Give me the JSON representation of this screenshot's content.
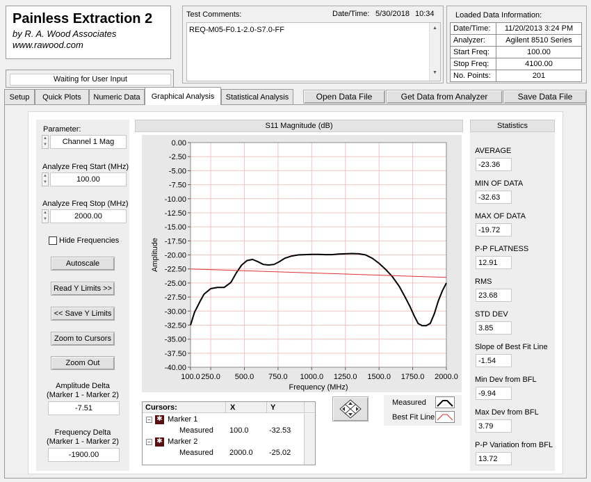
{
  "header": {
    "title": "Painless Extraction 2",
    "company": "by R. A. Wood Associates",
    "website": "www.rawood.com",
    "status": "Waiting for User Input"
  },
  "comments": {
    "label": "Test Comments:",
    "datetime_label": "Date/Time:",
    "date": "5/30/2018",
    "time": "10:34",
    "text": "REQ-M05-F0.1-2.0-S7.0-FF"
  },
  "loaded_data": {
    "title": "Loaded Data Information:",
    "rows": [
      {
        "key": "Date/Time:",
        "value": "11/20/2013 3:24 PM"
      },
      {
        "key": "Analyzer:",
        "value": "Agilent 8510 Series"
      },
      {
        "key": "Start Freq:",
        "value": "100.00"
      },
      {
        "key": "Stop Freq:",
        "value": "4100.00"
      },
      {
        "key": "No. Points:",
        "value": "201"
      }
    ]
  },
  "tabs": [
    "Setup",
    "Quick Plots",
    "Numeric Data",
    "Graphical Analysis",
    "Statistical Analysis"
  ],
  "actions": {
    "open": "Open Data File",
    "get": "Get Data from Analyzer",
    "save": "Save Data File"
  },
  "controls": {
    "parameter_label": "Parameter:",
    "parameter_value": "Channel 1 Mag",
    "start_label": "Analyze Freq Start (MHz)",
    "start_value": "100.00",
    "stop_label": "Analyze Freq Stop (MHz)",
    "stop_value": "2000.00",
    "hide_freq": "Hide Frequencies",
    "autoscale": "Autoscale",
    "read_y": "Read Y Limits >>",
    "save_y": "<< Save Y Limits",
    "zoom_cursors": "Zoom to Cursors",
    "zoom_out": "Zoom Out",
    "amp_delta_label1": "Amplitude Delta",
    "amp_delta_label2": "(Marker 1 - Marker 2)",
    "amp_delta_value": "-7.51",
    "freq_delta_label1": "Frequency Delta",
    "freq_delta_label2": "(Marker 1 - Marker 2)",
    "freq_delta_value": "-1900.00"
  },
  "cursors": {
    "header": "Cursors:",
    "col_x": "X",
    "col_y": "Y",
    "rows": [
      {
        "marker": "Marker 1",
        "trace": "Measured",
        "x": "100.0",
        "y": "-32.53"
      },
      {
        "marker": "Marker 2",
        "trace": "Measured",
        "x": "2000.0",
        "y": "-25.02"
      }
    ]
  },
  "legend": {
    "measured": "Measured",
    "bfl": "Best Fit Line"
  },
  "statistics": {
    "title": "Statistics",
    "items": [
      {
        "label": "AVERAGE",
        "value": "-23.36"
      },
      {
        "label": "MIN OF DATA",
        "value": "-32.63"
      },
      {
        "label": "MAX OF DATA",
        "value": "-19.72"
      },
      {
        "label": "P-P FLATNESS",
        "value": "12.91"
      },
      {
        "label": "RMS",
        "value": "23.68"
      },
      {
        "label": "STD DEV",
        "value": "3.85"
      },
      {
        "label": "Slope of Best Fit Line",
        "value": "-1.54"
      },
      {
        "label": "Min Dev from BFL",
        "value": "-9.94"
      },
      {
        "label": "Max Dev from BFL",
        "value": "3.79"
      },
      {
        "label": "P-P Variation from BFL",
        "value": "13.72"
      }
    ]
  },
  "chart_data": {
    "type": "line",
    "title": "S11 Magnitude (dB)",
    "xlabel": "Frequency (MHz)",
    "ylabel": "Amplitude",
    "xlim": [
      100,
      2000
    ],
    "ylim": [
      -40,
      0
    ],
    "xticks": [
      "100.0",
      "250.0",
      "500.0",
      "750.0",
      "1000.0",
      "1250.0",
      "1500.0",
      "1750.0",
      "2000.0"
    ],
    "yticks": [
      "0.00",
      "-2.50",
      "-5.00",
      "-7.50",
      "-10.00",
      "-12.50",
      "-15.00",
      "-17.50",
      "-20.00",
      "-22.50",
      "-25.00",
      "-27.50",
      "-30.00",
      "-32.50",
      "-35.00",
      "-37.50",
      "-40.00"
    ],
    "grid": true,
    "series": [
      {
        "name": "Measured",
        "color": "#000000",
        "x": [
          100,
          130,
          170,
          200,
          250,
          300,
          350,
          400,
          440,
          480,
          520,
          560,
          600,
          640,
          680,
          720,
          760,
          800,
          850,
          900,
          950,
          1000,
          1050,
          1100,
          1150,
          1200,
          1250,
          1300,
          1350,
          1400,
          1450,
          1500,
          1550,
          1600,
          1650,
          1700,
          1730,
          1760,
          1790,
          1820,
          1850,
          1880,
          1910,
          1940,
          1970,
          2000
        ],
        "y": [
          -32.5,
          -30.2,
          -28.3,
          -27.0,
          -26.0,
          -25.8,
          -25.8,
          -24.9,
          -23.2,
          -21.8,
          -21.0,
          -20.8,
          -21.2,
          -21.7,
          -21.8,
          -21.7,
          -21.2,
          -20.6,
          -20.2,
          -20.0,
          -19.95,
          -19.9,
          -19.9,
          -19.95,
          -19.95,
          -19.85,
          -19.8,
          -19.75,
          -19.8,
          -20.0,
          -20.6,
          -21.5,
          -22.6,
          -23.9,
          -25.6,
          -27.8,
          -29.2,
          -30.8,
          -32.2,
          -32.6,
          -32.6,
          -32.2,
          -30.5,
          -28.2,
          -26.4,
          -25.0
        ]
      },
      {
        "name": "Best Fit Line",
        "color": "#e03030",
        "x": [
          100,
          2000
        ],
        "y": [
          -22.5,
          -24.0
        ]
      }
    ]
  }
}
